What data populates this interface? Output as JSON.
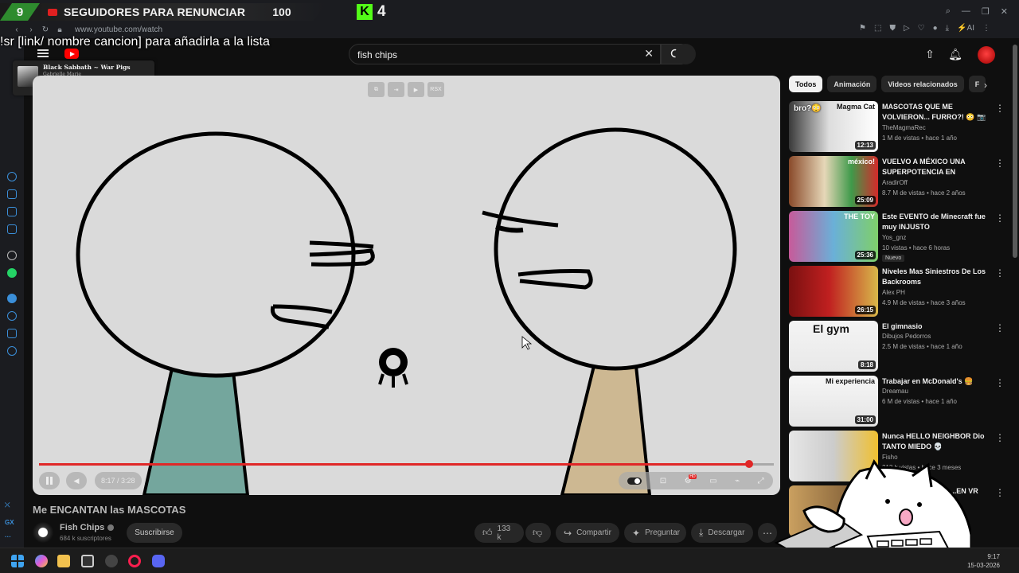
{
  "overlay": {
    "goal_count": "9",
    "goal_title": "SEGUIDORES PARA RENUNCIAR",
    "goal_target": "100",
    "kick_logo": "K",
    "kick_count": "4",
    "sr_instruction": "!sr [link/ nombre cancion] para añadirla a la lista",
    "now_playing": {
      "title": "Black Sabbath ~ War Pigs",
      "artist": "Gabrielle Marie",
      "accent": "#e4598f"
    }
  },
  "browser": {
    "url": "www.youtube.com/watch",
    "ai_label": "AI"
  },
  "header": {
    "search_value": "fish chips"
  },
  "player": {
    "top_controls": [
      "⧉",
      "⇥",
      "▶",
      "RSX"
    ],
    "progress": 0.966,
    "time_current": "8:17",
    "time_total": "3:28",
    "accent": "#e02727"
  },
  "video": {
    "title": "Me ENCANTAN las MASCOTAS",
    "channel": "Fish Chips",
    "subscribers": "684 k suscriptores",
    "subscribe_label": "Suscribirse",
    "likes": "133 k",
    "share_label": "Compartir",
    "ask_label": "Preguntar",
    "download_label": "Descargar"
  },
  "chips": [
    "Todos",
    "Animación",
    "Videos relacionados",
    "F"
  ],
  "recommendations": [
    {
      "title": "MASCOTAS QUE ME VOLVIERON... FURRO?! 😳 📷",
      "channel": "TheMagmaRec",
      "views": "1 M de vistas",
      "age": "hace 1 año",
      "duration": "12:13",
      "thumb_text": "Magma Cat",
      "thumb_text2": "bro?😳",
      "badge": ""
    },
    {
      "title": "VUELVO A MÉXICO UNA SUPERPOTENCIA EN VICTORI...",
      "channel": "AradirOff",
      "views": "8.7 M de vistas",
      "age": "hace 2 años",
      "duration": "25:09",
      "thumb_text": "méxico!",
      "thumb_text2": "",
      "badge": ""
    },
    {
      "title": "Este EVENTO de Minecraft fue muy INJUSTO",
      "channel": "Yos_gnz",
      "views": "10 vistas",
      "age": "hace 6 horas",
      "duration": "25:36",
      "thumb_text": "THE TOY",
      "thumb_text2": "",
      "badge": "Nuevo"
    },
    {
      "title": "Niveles Mas Siniestros De Los Backrooms",
      "channel": "Alex PH",
      "views": "4.9 M de vistas",
      "age": "hace 3 años",
      "duration": "26:15",
      "thumb_text": "",
      "thumb_text2": "",
      "badge": ""
    },
    {
      "title": "El gimnasio",
      "channel": "Dibujos Pedorros",
      "views": "2.5 M de vistas",
      "age": "hace 1 año",
      "duration": "8:18",
      "thumb_text": "El gym",
      "thumb_text2": "",
      "badge": ""
    },
    {
      "title": "Trabajar en McDonald's 🍔",
      "channel": "Dreamau",
      "views": "6 M de vistas",
      "age": "hace 1 año",
      "duration": "31:00",
      "thumb_text": "Mi experiencia",
      "thumb_text2": "",
      "badge": ""
    },
    {
      "title": "Nunca HELLO NEIGHBOR Dio TANTO MIEDO 💀",
      "channel": "Fisho",
      "views": "213 k vistas",
      "age": "hace 3 meses",
      "duration": "",
      "thumb_text": "",
      "thumb_text2": "",
      "badge": ""
    },
    {
      "title": "...DE HECHICERIA | ...EN VR",
      "channel": "",
      "views": "",
      "age": "hace 1 año",
      "duration": "",
      "thumb_text": "",
      "thumb_text2": "",
      "badge": ""
    }
  ],
  "taskbar": {
    "time": "9:17",
    "date": "15-03-2026"
  },
  "icons": [
    "hamburger-icon",
    "youtube-logo-icon",
    "search-icon",
    "close-icon",
    "mic-icon",
    "upload-icon",
    "bell-icon",
    "like-icon",
    "dislike-icon",
    "share-icon",
    "sparkle-icon",
    "download-icon",
    "kebab-icon",
    "windows-start-icon",
    "pause-icon",
    "volume-icon",
    "settings-icon",
    "fullscreen-icon"
  ]
}
